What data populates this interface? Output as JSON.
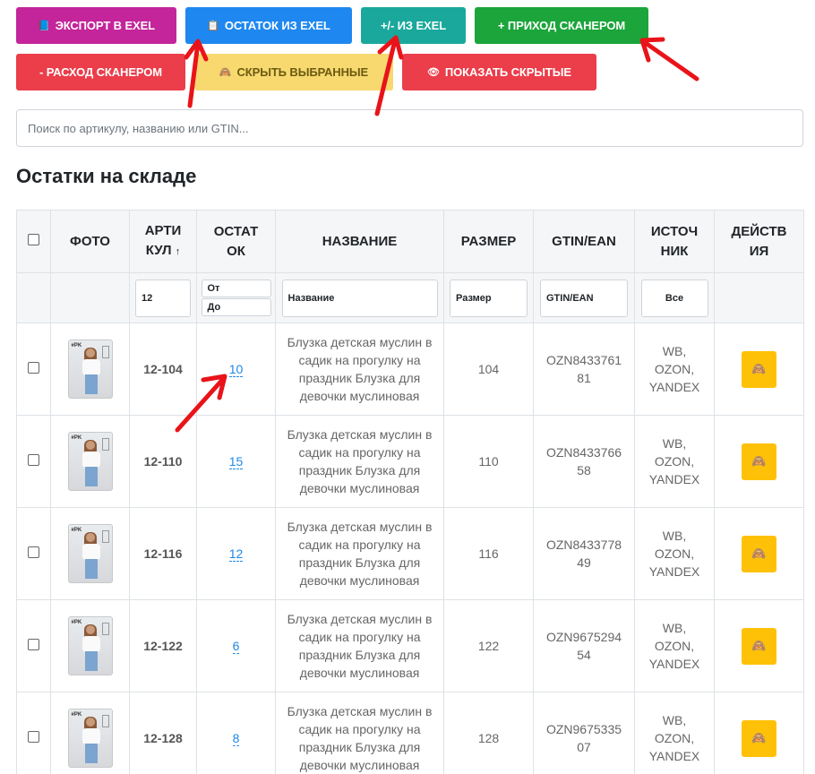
{
  "toolbar": {
    "export_excel": "ЭКСПОРТ В EXEL",
    "stock_from_excel": "ОСТАТОК ИЗ EXEL",
    "plusminus_excel": "+/- ИЗ EXEL",
    "scan_in": "+ ПРИХОД СКАНЕРОМ",
    "scan_out": "- РАСХОД СКАНЕРОМ",
    "hide_selected": "СКРЫТЬ ВЫБРАННЫЕ",
    "show_hidden": "ПОКАЗАТЬ СКРЫТЫЕ",
    "colors": {
      "magenta": "#c4259a",
      "blue": "#1e88f0",
      "teal": "#1aa89c",
      "green": "#1ba53b",
      "red": "#eb3d4a",
      "yellow": "#f7d970"
    }
  },
  "search": {
    "placeholder": "Поиск по артикулу, названию или GTIN..."
  },
  "title": "Остатки на складе",
  "table": {
    "headers": {
      "photo": "ФОТО",
      "art_1": "АРТИ",
      "art_2": "КУЛ",
      "art_sort": "↑",
      "stock_1": "ОСТАТ",
      "stock_2": "ОК",
      "name": "НАЗВАНИЕ",
      "size": "РАЗМЕР",
      "gtin": "GTIN/EAN",
      "source_1": "ИСТОЧ",
      "source_2": "НИК",
      "actions_1": "ДЕЙСТВ",
      "actions_2": "ИЯ"
    },
    "filters": {
      "art": "12",
      "stock_from": "От",
      "stock_to": "До",
      "name": "Название",
      "size": "Размер",
      "gtin": "GTIN/EAN",
      "source": "Все"
    },
    "rows": [
      {
        "art": "12-104",
        "qty": "10",
        "name": "Блузка детская муслин в садик на прогулку на праздник Блузка для девочки муслиновая",
        "size": "104",
        "gtin": "OZN843376181",
        "gtin_a": "OZN8433761",
        "gtin_b": "81",
        "src_1": "WB,",
        "src_2": "OZON,",
        "src_3": "YANDEX"
      },
      {
        "art": "12-110",
        "qty": "15",
        "name": "Блузка детская муслин в садик на прогулку на праздник Блузка для девочки муслиновая",
        "size": "110",
        "gtin": "OZN843376658",
        "gtin_a": "OZN8433766",
        "gtin_b": "58",
        "src_1": "WB,",
        "src_2": "OZON,",
        "src_3": "YANDEX"
      },
      {
        "art": "12-116",
        "qty": "12",
        "name": "Блузка детская муслин в садик на прогулку на праздник Блузка для девочки муслиновая",
        "size": "116",
        "gtin": "OZN843377849",
        "gtin_a": "OZN8433778",
        "gtin_b": "49",
        "src_1": "WB,",
        "src_2": "OZON,",
        "src_3": "YANDEX"
      },
      {
        "art": "12-122",
        "qty": "6",
        "name": "Блузка детская муслин в садик на прогулку на праздник Блузка для девочки муслиновая",
        "size": "122",
        "gtin": "OZN967529454",
        "gtin_a": "OZN9675294",
        "gtin_b": "54",
        "src_1": "WB,",
        "src_2": "OZON,",
        "src_3": "YANDEX"
      },
      {
        "art": "12-128",
        "qty": "8",
        "name": "Блузка детская муслин в садик на прогулку на праздник Блузка для девочки муслиновая",
        "size": "128",
        "gtin": "OZN967533507",
        "gtin_a": "OZN9675335",
        "gtin_b": "07",
        "src_1": "WB,",
        "src_2": "OZON,",
        "src_3": "YANDEX"
      }
    ]
  },
  "annotations": {
    "arrow_color": "#e8141a"
  }
}
